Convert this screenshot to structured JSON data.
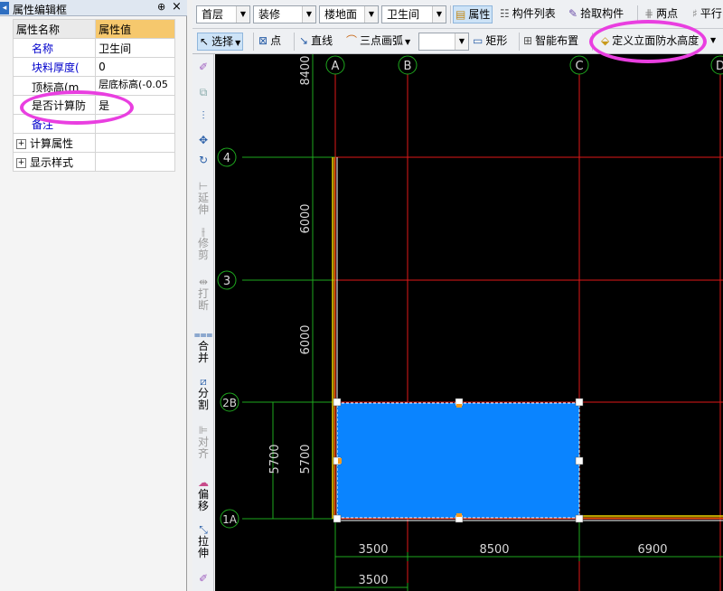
{
  "property_panel": {
    "title": "属性编辑框",
    "pin_glyph": "⊕",
    "close_glyph": "×",
    "header": {
      "name_col": "属性名称",
      "value_col": "属性值"
    },
    "rows": [
      {
        "name": "名称",
        "value": "卫生间",
        "blue": true
      },
      {
        "name": "块料厚度(",
        "value": "0",
        "blue": true
      },
      {
        "name": "顶标高(m",
        "value": "层底标高(-0.05",
        "blue": false
      },
      {
        "name": "是否计算防",
        "value": "是",
        "blue": false
      },
      {
        "name": "备注",
        "value": "",
        "blue": true
      },
      {
        "name": "计算属性",
        "value": "",
        "expander": "+"
      },
      {
        "name": "显示样式",
        "value": "",
        "expander": "+"
      }
    ]
  },
  "toolbar1": {
    "floor": "首层",
    "category": "装修",
    "component_type": "楼地面",
    "component": "卫生间",
    "buttons": {
      "properties": "属性",
      "component_list": "构件列表",
      "pick_component": "拾取构件",
      "two_points": "两点",
      "parallel": "平行"
    }
  },
  "toolbar2": {
    "select": "选择",
    "point": "点",
    "line": "直线",
    "arc": "三点画弧",
    "rect": "矩形",
    "smart_layout": "智能布置",
    "define_wall_waterproof": "定义立面防水高度"
  },
  "vertical_toolbar": {
    "extend": "延伸",
    "trim": "修剪",
    "break": "打断",
    "merge": "合并",
    "split": "分割",
    "align": "对齐",
    "offset": "偏移",
    "stretch": "拉伸"
  },
  "drawing": {
    "axis_labels": {
      "A": "A",
      "B": "B",
      "C": "C",
      "D": "D",
      "n4": "4",
      "n3": "3",
      "n2B": "2B",
      "n1A": "1A"
    },
    "dims_vertical": {
      "top": "8400",
      "mid1": "6000",
      "mid2": "6000",
      "bot_inner": "5700",
      "bot_outer": "5700"
    },
    "dims_horizontal": {
      "d1": "3500",
      "d2": "8500",
      "d3": "6900",
      "d1_second": "3500"
    },
    "colors": {
      "room_fill": "#0a84ff",
      "grid_line": "#e01818",
      "dim_line": "#1ea81e",
      "axis_circle": "#1ea81e",
      "highlight": "#e93fe0"
    }
  }
}
